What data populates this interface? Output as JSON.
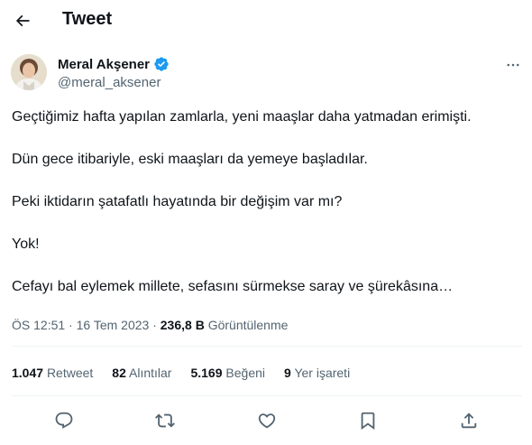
{
  "header": {
    "title": "Tweet",
    "back_icon": "arrow-left-icon"
  },
  "author": {
    "name": "Meral Akşener",
    "handle": "@meral_aksener",
    "verified_icon": "verified-badge-icon",
    "verified_color": "#1d9bf0"
  },
  "more_icon": "more-horizontal-icon",
  "tweet": {
    "paragraphs": [
      "Geçtiğimiz hafta yapılan zamlarla, yeni maaşlar daha yatmadan erimişti.",
      "Dün gece itibariyle, eski maaşları da yemeye başladılar.",
      "Peki iktidarın şatafatlı hayatında bir değişim var mı?",
      "Yok!",
      "Cefayı bal eylemek millete, sefasını sürmekse saray ve şürekâsına…"
    ]
  },
  "meta": {
    "time": "ÖS 12:51",
    "separator": "·",
    "date": "16 Tem 2023",
    "views_count": "236,8 B",
    "views_label": "Görüntülenme"
  },
  "stats": {
    "retweets_count": "1.047",
    "retweets_label": "Retweet",
    "quotes_count": "82",
    "quotes_label": "Alıntılar",
    "likes_count": "5.169",
    "likes_label": "Beğeni",
    "bookmarks_count": "9",
    "bookmarks_label": "Yer işareti"
  },
  "actions": [
    "reply-icon",
    "retweet-icon",
    "like-icon",
    "bookmark-icon",
    "share-icon"
  ],
  "colors": {
    "text": "#0f1419",
    "secondary": "#536471",
    "divider": "#eff3f4",
    "accent": "#1d9bf0"
  }
}
